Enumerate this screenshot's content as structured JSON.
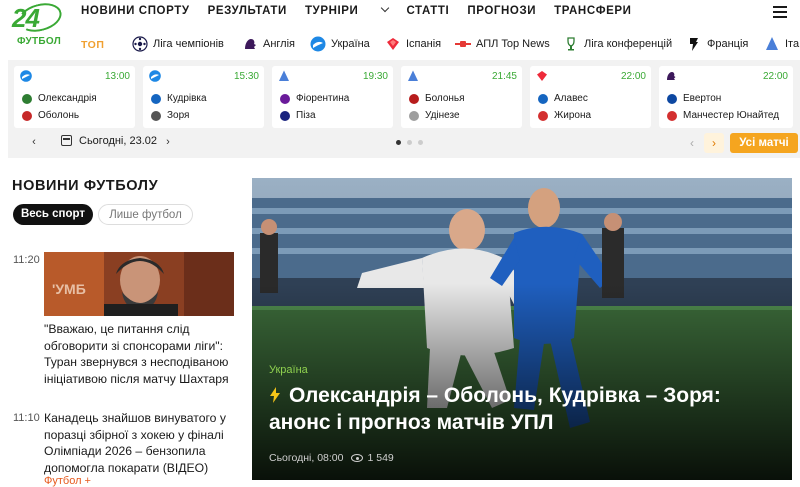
{
  "logo": {
    "number": "24",
    "word": "ФУТБОЛ"
  },
  "menu": {
    "items": [
      "НОВИНИ СПОРТУ",
      "РЕЗУЛЬТАТИ",
      "ТУРНІРИ",
      "СТАТТІ",
      "ПРОГНОЗИ",
      "ТРАНСФЕРИ"
    ]
  },
  "leagues": {
    "top_label": "ТОП",
    "items": [
      {
        "label": "Ліга чемпіонів",
        "icon": "champions-league-icon"
      },
      {
        "label": "Англія",
        "icon": "premier-league-icon"
      },
      {
        "label": "Україна",
        "icon": "upl-icon"
      },
      {
        "label": "Іспанія",
        "icon": "laliga-icon"
      },
      {
        "label": "АПЛ Top News",
        "icon": "apl-icon"
      },
      {
        "label": "Ліга конференцій",
        "icon": "conference-league-icon"
      },
      {
        "label": "Франція",
        "icon": "ligue1-icon"
      },
      {
        "label": "Іта",
        "icon": "seriea-icon"
      }
    ]
  },
  "matches": [
    {
      "time": "13:00",
      "home": "Олександрія",
      "away": "Оболонь",
      "league": "upl",
      "home_color": "#2e7d32",
      "away_color": "#c62828"
    },
    {
      "time": "15:30",
      "home": "Кудрівка",
      "away": "Зоря",
      "league": "upl",
      "home_color": "#1565c0",
      "away_color": "#555555"
    },
    {
      "time": "19:30",
      "home": "Фіорентина",
      "away": "Піза",
      "league": "seriea",
      "home_color": "#6a1b9a",
      "away_color": "#1a237e"
    },
    {
      "time": "21:45",
      "home": "Болонья",
      "away": "Удінезе",
      "league": "seriea",
      "home_color": "#b71c1c",
      "away_color": "#9e9e9e"
    },
    {
      "time": "22:00",
      "home": "Алавес",
      "away": "Жирона",
      "league": "laliga",
      "home_color": "#1565c0",
      "away_color": "#d32f2f"
    },
    {
      "time": "22:00",
      "home": "Евертон",
      "away": "Манчестер Юнайтед",
      "league": "epl",
      "home_color": "#0d47a1",
      "away_color": "#d32f2f"
    }
  ],
  "datebar": {
    "date": "Сьогодні, 23.02",
    "all_matches": "Усі матчі"
  },
  "news": {
    "title": "НОВИНИ ФУТБОЛУ",
    "tab_all": "Весь спорт",
    "tab_football": "Лише футбол",
    "items": [
      {
        "time": "11:20",
        "text": "\"Вважаю, це питання слід обговорити зі спонсорами ліги\": Туран звернувся з несподіваною ініціативою після матчу Шахтаря"
      },
      {
        "time": "11:10",
        "text": "Канадець знайшов винуватого у поразці збірної з хокею у фіналі Олімпіади 2026 – бензопила допомогла покарати (ВІДЕО)",
        "tag": "Футбол +"
      }
    ]
  },
  "hero": {
    "category": "Україна",
    "headline": "Олександрія – Оболонь, Кудрівка – Зоря: анонс і прогноз матчів УПЛ",
    "date": "Сьогодні, 08:00",
    "views": "1 549"
  },
  "colors": {
    "brand": "#3aa935",
    "accent": "#f5a51f",
    "tag": "#e65a1e"
  }
}
